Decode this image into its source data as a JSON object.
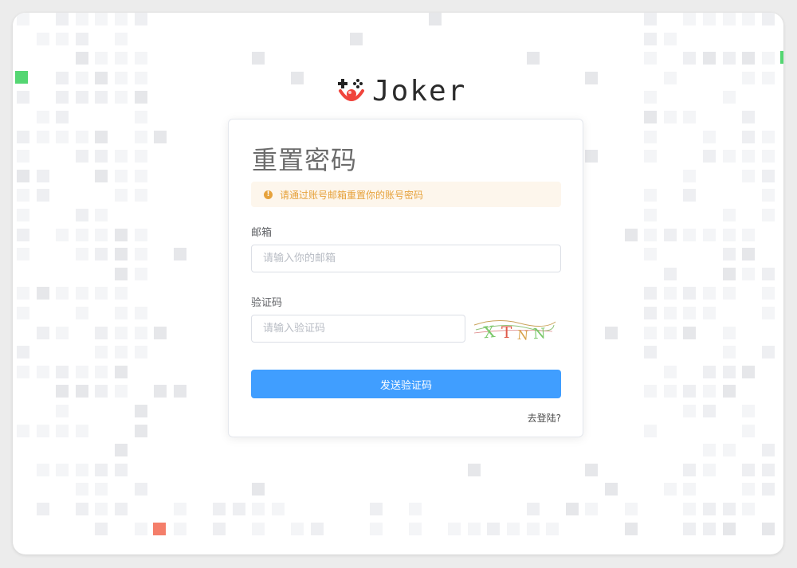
{
  "brand": {
    "name": "Joker"
  },
  "card": {
    "title": "重置密码",
    "alert": "请通过账号邮箱重置你的账号密码",
    "email": {
      "label": "邮箱",
      "placeholder": "请输入你的邮箱"
    },
    "code": {
      "label": "验证码",
      "placeholder": "请输入验证码",
      "captcha_text": "XTNN"
    },
    "send_button": "发送验证码",
    "login_link": "去登陆?"
  },
  "colors": {
    "primary": "#409eff",
    "alert_bg": "#fdf6ec",
    "alert_text": "#e6a23c",
    "accent_green": "#54d672",
    "accent_red": "#f47e6a",
    "logo_red": "#f0443c"
  }
}
